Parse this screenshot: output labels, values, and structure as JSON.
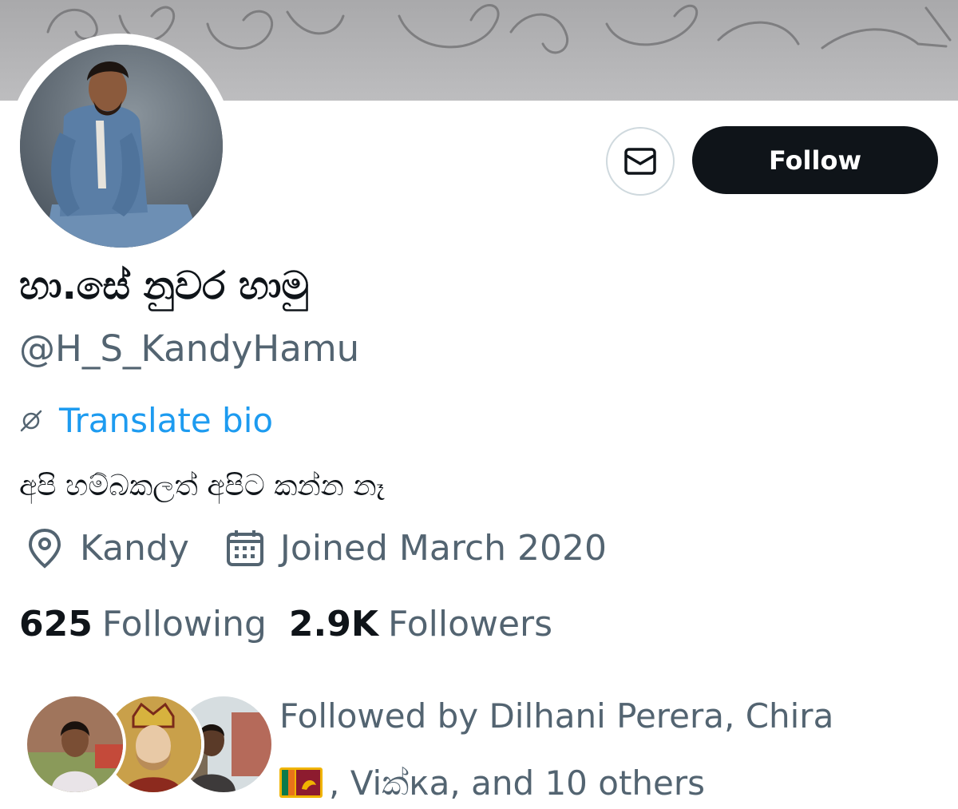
{
  "profile": {
    "display_name": "හා.සේ නුවර හාමු",
    "handle": "@H_S_KandyHamu",
    "translate_label": "Translate bio",
    "bio": "අපි හම්බකලත් අපිට කන්න නෑ",
    "location": "Kandy",
    "joined": "Joined March 2020"
  },
  "actions": {
    "follow_label": "Follow",
    "message_icon": "envelope-icon"
  },
  "stats": {
    "following_count": "625",
    "following_label": "Following",
    "followers_count": "2.9K",
    "followers_label": "Followers"
  },
  "followed_by": {
    "prefix": "Followed by Dilhani Perera, Chira",
    "flag_icon": "sri-lanka-flag-icon",
    "suffix": ", Viක්ка, and 10 others"
  },
  "colors": {
    "accent": "#1d9bf0",
    "text_primary": "#0f1419",
    "text_secondary": "#536471",
    "follow_button_bg": "#0f1419"
  }
}
